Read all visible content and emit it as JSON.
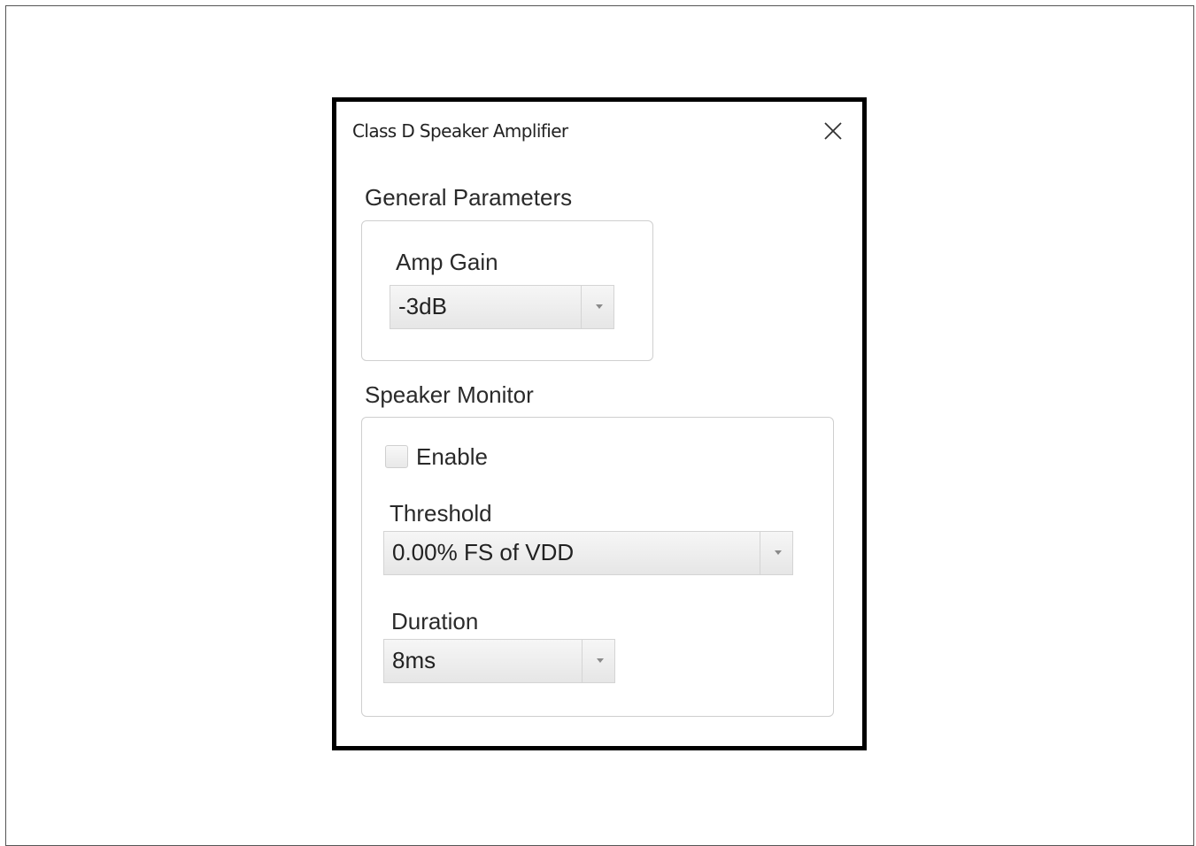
{
  "dialog": {
    "title": "Class D Speaker Amplifier",
    "close_icon": "close-icon"
  },
  "general": {
    "heading": "General Parameters",
    "amp_gain": {
      "label": "Amp Gain",
      "value": "-3dB"
    }
  },
  "monitor": {
    "heading": "Speaker Monitor",
    "enable": {
      "label": "Enable",
      "checked": false
    },
    "threshold": {
      "label": "Threshold",
      "value": "0.00% FS of VDD"
    },
    "duration": {
      "label": "Duration",
      "value": "8ms"
    }
  }
}
